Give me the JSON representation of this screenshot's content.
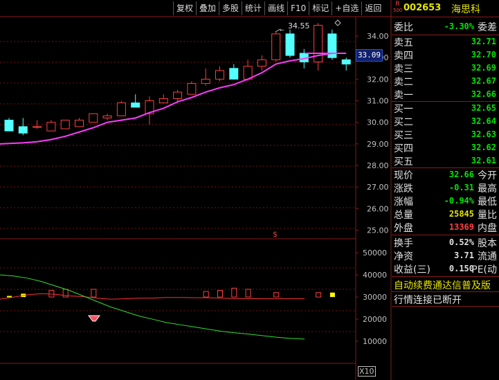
{
  "toolbar": {
    "buttons": [
      "复权",
      "叠加",
      "多股",
      "统计",
      "画线",
      "F10",
      "标记",
      "+自选",
      "返回"
    ]
  },
  "stock": {
    "badge_top": "R",
    "badge_bottom": "500",
    "code": "002653",
    "name": "海思科"
  },
  "order_book": {
    "weibi_label": "委比",
    "weibi_value": "-3.30%",
    "weicha_label": "委差",
    "asks": [
      {
        "label": "卖五",
        "price": "32.71"
      },
      {
        "label": "卖四",
        "price": "32.70"
      },
      {
        "label": "卖三",
        "price": "32.69"
      },
      {
        "label": "卖二",
        "price": "32.67"
      },
      {
        "label": "卖一",
        "price": "32.66"
      }
    ],
    "bids": [
      {
        "label": "买一",
        "price": "32.65"
      },
      {
        "label": "买二",
        "price": "32.64"
      },
      {
        "label": "买三",
        "price": "32.63"
      },
      {
        "label": "买四",
        "price": "32.62"
      },
      {
        "label": "买五",
        "price": "32.61"
      }
    ]
  },
  "quote": [
    {
      "label": "现价",
      "value": "32.66",
      "color": "green",
      "label2": "今开"
    },
    {
      "label": "涨跌",
      "value": "-0.31",
      "color": "green",
      "label2": "最高"
    },
    {
      "label": "涨幅",
      "value": "-0.94%",
      "color": "green",
      "label2": "最低"
    },
    {
      "label": "总量",
      "value": "25845",
      "color": "yellow",
      "label2": "量比"
    },
    {
      "label": "外盘",
      "value": "13369",
      "color": "red",
      "label2": "内盘"
    }
  ],
  "finance": [
    {
      "label": "换手",
      "value": "0.52%",
      "label2": "股本"
    },
    {
      "label": "净资",
      "value": "3.71",
      "label2": "流通"
    },
    {
      "label": "收益(三)",
      "value": "0.150",
      "label2": "PE(动"
    }
  ],
  "notices": {
    "line1": "自动续费通达信普及版",
    "line2": "行情连接已断开"
  },
  "price_axis": {
    "ticks": [
      "34.00",
      "33.00",
      "32.00",
      "31.00",
      "30.00",
      "29.00",
      "28.00",
      "27.00",
      "26.00",
      "25.00"
    ],
    "current_price": "33.09",
    "high_marker": "34.55"
  },
  "volume_axis": {
    "ticks": [
      "50000",
      "40000",
      "30000",
      "20000",
      "10000"
    ],
    "unit": "X10"
  },
  "chart_data": {
    "type": "candlestick",
    "price_range": [
      24.6,
      34.9
    ],
    "candles": [
      {
        "o": 30.1,
        "h": 30.2,
        "l": 29.6,
        "c": 29.6
      },
      {
        "o": 29.8,
        "h": 30.2,
        "l": 29.4,
        "c": 29.5
      },
      {
        "o": 29.8,
        "h": 30.1,
        "l": 29.7,
        "c": 29.8
      },
      {
        "o": 29.6,
        "h": 30.1,
        "l": 29.6,
        "c": 30.0
      },
      {
        "o": 29.7,
        "h": 30.1,
        "l": 29.7,
        "c": 30.1
      },
      {
        "o": 29.8,
        "h": 30.2,
        "l": 29.8,
        "c": 30.1
      },
      {
        "o": 30.0,
        "h": 30.4,
        "l": 30.0,
        "c": 30.4
      },
      {
        "o": 30.2,
        "h": 30.4,
        "l": 30.1,
        "c": 30.3
      },
      {
        "o": 30.3,
        "h": 31.0,
        "l": 30.3,
        "c": 30.9
      },
      {
        "o": 30.9,
        "h": 31.3,
        "l": 30.7,
        "c": 30.7
      },
      {
        "o": 30.4,
        "h": 31.2,
        "l": 29.9,
        "c": 31.0
      },
      {
        "o": 30.9,
        "h": 31.3,
        "l": 30.9,
        "c": 31.1
      },
      {
        "o": 31.1,
        "h": 31.5,
        "l": 30.9,
        "c": 31.4
      },
      {
        "o": 31.3,
        "h": 31.9,
        "l": 31.3,
        "c": 31.8
      },
      {
        "o": 31.8,
        "h": 32.5,
        "l": 31.7,
        "c": 32.0
      },
      {
        "o": 32.0,
        "h": 32.6,
        "l": 31.9,
        "c": 32.4
      },
      {
        "o": 32.5,
        "h": 32.7,
        "l": 32.0,
        "c": 32.0
      },
      {
        "o": 32.0,
        "h": 32.9,
        "l": 31.9,
        "c": 32.6
      },
      {
        "o": 32.6,
        "h": 33.1,
        "l": 32.4,
        "c": 32.9
      },
      {
        "o": 32.9,
        "h": 34.2,
        "l": 32.8,
        "c": 34.1
      },
      {
        "o": 34.1,
        "h": 34.3,
        "l": 33.0,
        "c": 33.1
      },
      {
        "o": 33.2,
        "h": 33.4,
        "l": 32.5,
        "c": 32.8
      },
      {
        "o": 32.8,
        "h": 34.6,
        "l": 32.4,
        "c": 34.5
      },
      {
        "o": 34.1,
        "h": 34.3,
        "l": 32.9,
        "c": 33.0
      },
      {
        "o": 32.9,
        "h": 33.0,
        "l": 32.4,
        "c": 32.7
      }
    ],
    "ma": [
      29.0,
      29.05,
      29.1,
      29.2,
      29.35,
      29.55,
      29.75,
      30.0,
      30.1,
      30.2,
      30.45,
      30.65,
      30.95,
      31.15,
      31.4,
      31.6,
      31.75,
      32.0,
      32.3,
      32.7,
      32.85,
      32.95,
      33.1,
      33.2,
      33.2
    ],
    "volume_range": [
      0,
      56000
    ],
    "volume": [
      {
        "v": 30500,
        "type": "yellow"
      },
      {
        "v": 31500,
        "type": "yellow"
      },
      {
        "v": 31000,
        "type": "none"
      },
      {
        "v": 33000,
        "type": "outline"
      },
      {
        "v": 33500,
        "type": "outline"
      },
      {
        "v": 30000,
        "type": "none"
      },
      {
        "v": 33500,
        "type": "outline"
      },
      {
        "v": 30000,
        "type": "none"
      },
      {
        "v": 30000,
        "type": "none"
      },
      {
        "v": 30000,
        "type": "none"
      },
      {
        "v": 30000,
        "type": "none"
      },
      {
        "v": 30000,
        "type": "none"
      },
      {
        "v": 30000,
        "type": "none"
      },
      {
        "v": 30000,
        "type": "none"
      },
      {
        "v": 32500,
        "type": "outline"
      },
      {
        "v": 33000,
        "type": "outline"
      },
      {
        "v": 34000,
        "type": "outline"
      },
      {
        "v": 33500,
        "type": "outline"
      },
      {
        "v": 30000,
        "type": "none"
      },
      {
        "v": 32000,
        "type": "outline"
      },
      {
        "v": 30000,
        "type": "none"
      },
      {
        "v": 30000,
        "type": "none"
      },
      {
        "v": 32000,
        "type": "outline"
      },
      {
        "v": 32000,
        "type": "yellow"
      },
      {
        "v": 30000,
        "type": "none"
      }
    ],
    "vol_ma_red": [
      29000,
      30000,
      31000,
      31500,
      31200,
      30500,
      30200,
      29500,
      29000,
      29200,
      29500,
      29500,
      29800,
      29800,
      29700,
      29700,
      29500,
      29300,
      29300,
      29200,
      29200,
      29200,
      29200
    ],
    "vol_ma_green": [
      40000,
      39500,
      38500,
      37000,
      35000,
      33000,
      30500,
      28000,
      25500,
      23500,
      21500,
      20000,
      18500,
      17500,
      16500,
      15500,
      14500,
      13800,
      13200,
      12500,
      11800,
      11300,
      11000
    ]
  }
}
